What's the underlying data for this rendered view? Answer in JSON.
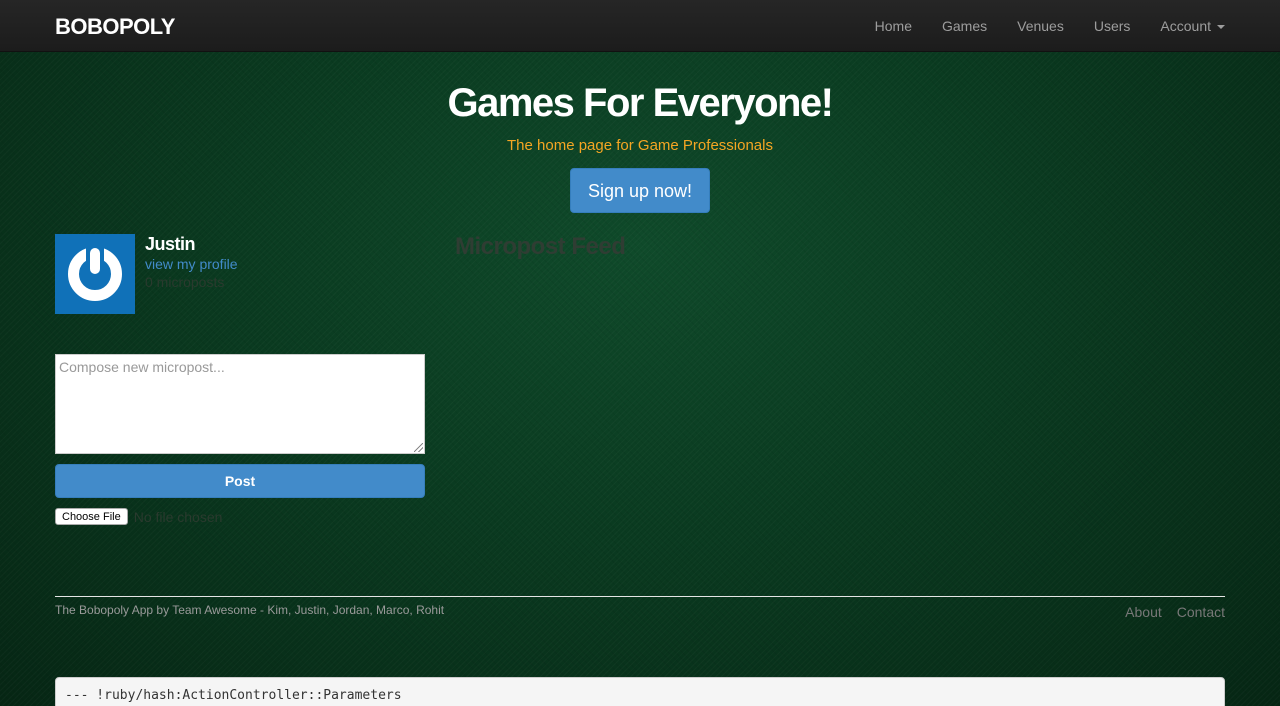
{
  "navbar": {
    "brand": "BOBOPOLY",
    "links": [
      "Home",
      "Games",
      "Venues",
      "Users"
    ],
    "account_label": "Account"
  },
  "hero": {
    "title": "Games For Everyone!",
    "tagline": "The home page for Game Professionals",
    "signup_label": "Sign up now!"
  },
  "profile": {
    "name": "Justin",
    "profile_link": "view my profile",
    "micropost_count": "0 microposts"
  },
  "feed": {
    "title": "Micropost Feed"
  },
  "composer": {
    "placeholder": "Compose new micropost...",
    "post_label": "Post",
    "choose_file_label": "Choose File",
    "no_file_text": "No file chosen"
  },
  "footer": {
    "credit": "The Bobopoly App by Team Awesome - Kim, Justin, Jordan, Marco, Rohit",
    "links": [
      "About",
      "Contact"
    ]
  },
  "debug": {
    "text": "--- !ruby/hash:ActionController::Parameters"
  },
  "colors": {
    "accent": "#428bca",
    "tagline": "#f5a623",
    "navbar": "#222222",
    "background": "#0b3a1f"
  }
}
